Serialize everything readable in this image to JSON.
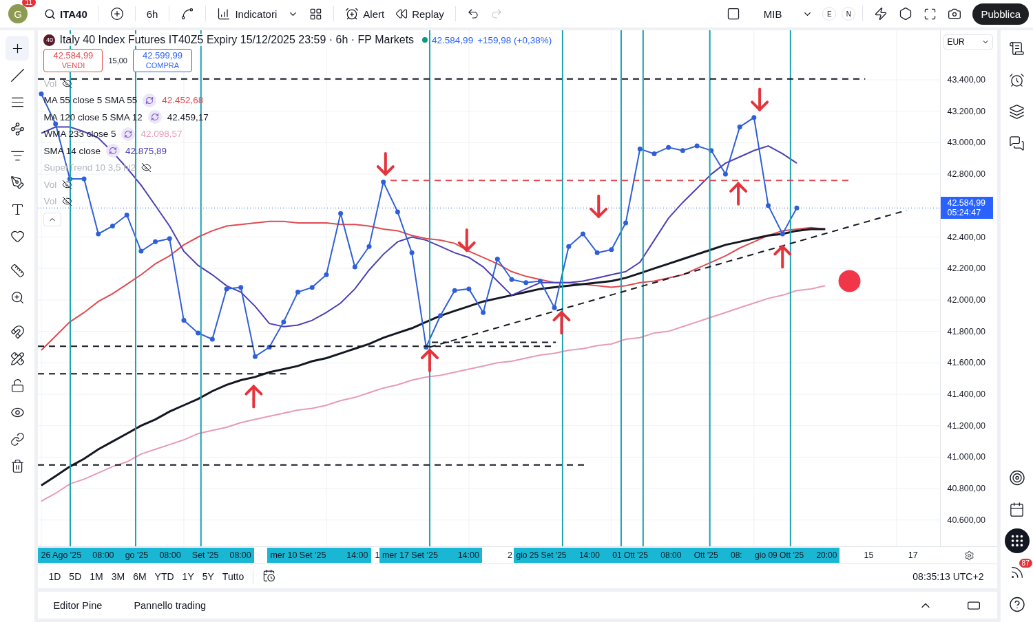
{
  "top_bar": {
    "avatar": {
      "initial": "G",
      "badge": "11"
    },
    "symbol": "ITA40",
    "interval": "6h",
    "indicators": "Indicatori",
    "alert": "Alert",
    "replay": "Replay",
    "undo": {
      "disabled": false
    },
    "redo": {
      "disabled": true
    },
    "exchange": "MIB",
    "sessions": [
      "E",
      "N"
    ],
    "publish": "Pubblica"
  },
  "drawing_tools": [
    {
      "selected": true
    },
    {
      "selected": false
    },
    {
      "selected": false
    },
    {
      "selected": false
    },
    {
      "selected": false
    },
    {
      "selected": false
    },
    {
      "selected": false
    },
    {
      "selected": false
    },
    {
      "selected": false
    },
    {
      "selected": false
    },
    {
      "selected": false
    },
    {
      "selected": false
    },
    {
      "selected": false
    },
    {
      "selected": false
    },
    {
      "selected": false
    },
    {
      "selected": false
    }
  ],
  "chart": {
    "header": {
      "badge": "40",
      "title": "Italy 40 Index Futures IT40Z5 Expiry 15/12/2025 23:59 · 6h · FP Markets",
      "price": "42.584,99",
      "change": "+159,98 (+0,38%)"
    },
    "trade": {
      "sell": {
        "price": "42.584,99",
        "label": "VENDI"
      },
      "spread": "15,00",
      "buy": {
        "price": "42.599,99",
        "label": "COMPRA"
      }
    },
    "legend": [
      {
        "kind": "hidden",
        "label": "Vol"
      },
      {
        "kind": "study",
        "label": "MA 55 close 5 SMA 55",
        "value": "42.452,68",
        "color": "#e04a50"
      },
      {
        "kind": "study",
        "label": "MA 120 close 5 SMA 12",
        "value": "42.459,17",
        "color": "#131722"
      },
      {
        "kind": "study",
        "label": "WMA 233 close 5",
        "value": "42.098,57",
        "color": "#e89ab5"
      },
      {
        "kind": "study",
        "label": "SMA 14 close",
        "value": "42.875,89",
        "color": "#4b3fb5"
      },
      {
        "kind": "hidden",
        "label": "SuperTrend 10 3,5 hl2"
      },
      {
        "kind": "hidden",
        "label": "Vol"
      },
      {
        "kind": "hidden",
        "label": "Vol"
      }
    ],
    "chart_data": {
      "type": "line",
      "ylim": [
        40433,
        43715
      ],
      "grid": true,
      "yticks": [
        {
          "value": 43400,
          "label": "43.400,00"
        },
        {
          "value": 43200,
          "label": "43.200,00"
        },
        {
          "value": 43000,
          "label": "43.000,00"
        },
        {
          "value": 42800,
          "label": "42.800,00"
        },
        {
          "value": 42400,
          "label": "42.400,00"
        },
        {
          "value": 42200,
          "label": "42.200,00"
        },
        {
          "value": 42000,
          "label": "42.000,00"
        },
        {
          "value": 41800,
          "label": "41.800,00"
        },
        {
          "value": 41600,
          "label": "41.600,00"
        },
        {
          "value": 41400,
          "label": "41.400,00"
        },
        {
          "value": 41200,
          "label": "41.200,00"
        },
        {
          "value": 41000,
          "label": "41.000,00"
        },
        {
          "value": 40800,
          "label": "40.800,00"
        },
        {
          "value": 40600,
          "label": "40.600,00"
        }
      ],
      "series": [
        {
          "color": "#e89ab5",
          "values": [
            40720,
            40770,
            40830,
            40860,
            40900,
            40940,
            40970,
            41020,
            41050,
            41080,
            41110,
            41150,
            41170,
            41190,
            41220,
            41240,
            41260,
            41280,
            41300,
            41310,
            41330,
            41360,
            41380,
            41410,
            41440,
            41460,
            41490,
            41510,
            41520,
            41540,
            41560,
            41580,
            41600,
            41610,
            41630,
            41650,
            41660,
            41680,
            41690,
            41710,
            41720,
            41750,
            41760,
            41790,
            41800,
            41830,
            41860,
            41890,
            41920,
            41950,
            41980,
            42010,
            42030,
            42060,
            42070,
            42090
          ]
        },
        {
          "color": "#e04a50",
          "values": [
            41680,
            41770,
            41860,
            41920,
            41990,
            42040,
            42100,
            42160,
            42230,
            42280,
            42350,
            42400,
            42440,
            42470,
            42480,
            42490,
            42500,
            42500,
            42490,
            42490,
            42490,
            42480,
            42480,
            42470,
            42450,
            42440,
            42410,
            42390,
            42380,
            42360,
            42310,
            42270,
            42230,
            42180,
            42150,
            42130,
            42110,
            42110,
            42100,
            42090,
            42080,
            42090,
            42110,
            42120,
            42140,
            42160,
            42200,
            42240,
            42280,
            42330,
            42370,
            42410,
            42440,
            42450,
            42460,
            42450
          ]
        },
        {
          "color": "#131722",
          "values": [
            40820,
            40880,
            40940,
            40990,
            41050,
            41100,
            41150,
            41200,
            41240,
            41290,
            41330,
            41370,
            41420,
            41460,
            41490,
            41510,
            41540,
            41560,
            41580,
            41610,
            41630,
            41660,
            41690,
            41720,
            41760,
            41790,
            41820,
            41860,
            41900,
            41930,
            41960,
            41990,
            42010,
            42030,
            42050,
            42070,
            42080,
            42090,
            42100,
            42110,
            42120,
            42140,
            42170,
            42200,
            42230,
            42260,
            42290,
            42320,
            42350,
            42370,
            42390,
            42410,
            42420,
            42440,
            42450,
            42450
          ]
        },
        {
          "color": "#4b3fb5",
          "values": [
            43060,
            43100,
            43100,
            43070,
            43030,
            42940,
            42840,
            42730,
            42600,
            42470,
            42310,
            42220,
            42160,
            42090,
            42050,
            41960,
            41850,
            41830,
            41840,
            41870,
            41920,
            41980,
            42070,
            42190,
            42290,
            42370,
            42400,
            42380,
            42340,
            42300,
            42270,
            42210,
            42120,
            42030,
            42070,
            42110,
            42110,
            42110,
            42120,
            42140,
            42160,
            42180,
            42240,
            42380,
            42520,
            42620,
            42710,
            42800,
            42870,
            42910,
            42950,
            42980,
            42930,
            42870,
            null,
            null
          ]
        },
        {
          "color": "#2f5fd8",
          "marker": "circle",
          "values": [
            43310,
            43120,
            42770,
            42770,
            42420,
            42470,
            42540,
            42310,
            42370,
            42390,
            41870,
            41790,
            41750,
            42070,
            42080,
            41640,
            41700,
            41860,
            42050,
            42080,
            42160,
            42550,
            42210,
            42340,
            42750,
            42560,
            42300,
            41700,
            41900,
            42060,
            42070,
            41920,
            42260,
            42130,
            42110,
            42120,
            41950,
            42340,
            42420,
            42300,
            42320,
            42490,
            42960,
            42930,
            42970,
            42950,
            42980,
            42950,
            42800,
            43100,
            43160,
            42600,
            42420,
            42585,
            null,
            null
          ]
        }
      ]
    },
    "last_price": {
      "label": "42.584,99",
      "countdown": "05:24:47"
    },
    "currency": "EUR",
    "time_axis": [
      {
        "highlighted": true,
        "labels": [
          "26 Ago '25",
          "08:00",
          "go '25",
          "08:00",
          "Set '25",
          "08:00"
        ]
      },
      {
        "highlighted": true,
        "labels": [
          "mer 10 Set '25",
          "14:00"
        ]
      },
      {
        "highlighted": false,
        "labels": [
          "1"
        ]
      },
      {
        "highlighted": true,
        "labels": [
          "mer 17 Set '25",
          "14:00"
        ]
      },
      {
        "highlighted": false,
        "labels": [
          "2"
        ]
      },
      {
        "highlighted": true,
        "labels": [
          "gio 25 Set '25",
          "14:00",
          "01 Ott '25",
          "08:00",
          "Ott '25",
          "08:",
          "gio 09 Ott '25",
          "20:00"
        ]
      },
      {
        "highlighted": false,
        "labels": [
          "15"
        ]
      },
      {
        "highlighted": false,
        "labels": [
          "17"
        ]
      }
    ]
  },
  "range_bar": {
    "ranges": [
      "1D",
      "5D",
      "1M",
      "3M",
      "6M",
      "YTD",
      "1Y",
      "5Y",
      "Tutto"
    ],
    "clock": "08:35:13 UTC+2"
  },
  "bottom_panel": {
    "tabs": [
      "Editor Pine",
      "Pannello trading"
    ]
  },
  "right_bar": {
    "feed_badge": "87"
  }
}
